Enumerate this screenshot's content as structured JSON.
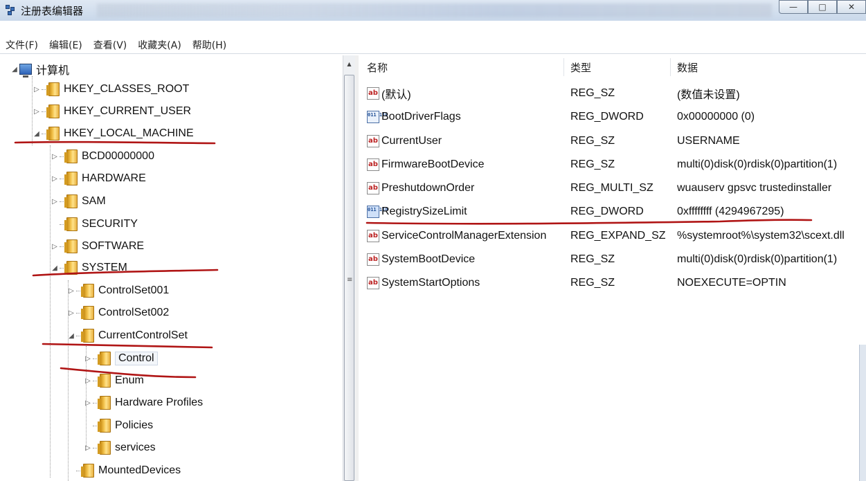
{
  "window": {
    "title": "注册表编辑器"
  },
  "window_buttons": [
    "—",
    "□",
    "✕"
  ],
  "menu": [
    "文件(F)",
    "编辑(E)",
    "查看(V)",
    "收藏夹(A)",
    "帮助(H)"
  ],
  "tree": {
    "root": "计算机",
    "nodes": [
      {
        "label": "HKEY_CLASSES_ROOT",
        "expander": "▷"
      },
      {
        "label": "HKEY_CURRENT_USER",
        "expander": "▷"
      },
      {
        "label": "HKEY_LOCAL_MACHINE",
        "expander": "◢"
      },
      {
        "label": "BCD00000000",
        "expander": "▷"
      },
      {
        "label": "HARDWARE",
        "expander": "▷"
      },
      {
        "label": "SAM",
        "expander": "▷"
      },
      {
        "label": "SECURITY",
        "expander": ""
      },
      {
        "label": "SOFTWARE",
        "expander": "▷"
      },
      {
        "label": "SYSTEM",
        "expander": "◢"
      },
      {
        "label": "ControlSet001",
        "expander": "▷"
      },
      {
        "label": "ControlSet002",
        "expander": "▷"
      },
      {
        "label": "CurrentControlSet",
        "expander": "◢"
      },
      {
        "label": "Control",
        "expander": "▷"
      },
      {
        "label": "Enum",
        "expander": "▷"
      },
      {
        "label": "Hardware Profiles",
        "expander": "▷"
      },
      {
        "label": "Policies",
        "expander": ""
      },
      {
        "label": "services",
        "expander": "▷"
      },
      {
        "label": "MountedDevices",
        "expander": ""
      }
    ]
  },
  "list": {
    "columns": [
      "名称",
      "类型",
      "数据"
    ],
    "rows": [
      {
        "icon": "string-value-icon",
        "name": "(默认)",
        "type": "REG_SZ",
        "data": "(数值未设置)"
      },
      {
        "icon": "binary-value-icon",
        "name": "BootDriverFlags",
        "type": "REG_DWORD",
        "data": "0x00000000 (0)"
      },
      {
        "icon": "string-value-icon",
        "name": "CurrentUser",
        "type": "REG_SZ",
        "data": "USERNAME"
      },
      {
        "icon": "string-value-icon",
        "name": "FirmwareBootDevice",
        "type": "REG_SZ",
        "data": "multi(0)disk(0)rdisk(0)partition(1)"
      },
      {
        "icon": "string-value-icon",
        "name": "PreshutdownOrder",
        "type": "REG_MULTI_SZ",
        "data": "wuauserv gpsvc trustedinstaller"
      },
      {
        "icon": "binary-value-icon",
        "name": "RegistrySizeLimit",
        "type": "REG_DWORD",
        "data": "0xffffffff (4294967295)"
      },
      {
        "icon": "string-value-icon",
        "name": "ServiceControlManagerExtension",
        "type": "REG_EXPAND_SZ",
        "data": "%systemroot%\\system32\\scext.dll"
      },
      {
        "icon": "string-value-icon",
        "name": "SystemBootDevice",
        "type": "REG_SZ",
        "data": "multi(0)disk(0)rdisk(0)partition(1)"
      },
      {
        "icon": "string-value-icon",
        "name": "SystemStartOptions",
        "type": "REG_SZ",
        "data": " NOEXECUTE=OPTIN"
      }
    ]
  },
  "icons": {
    "string_value": "ab",
    "binary_value": "011 110"
  },
  "colors": {
    "annotation_red": "#b01515",
    "folder_yellow": "#f2c14a"
  }
}
